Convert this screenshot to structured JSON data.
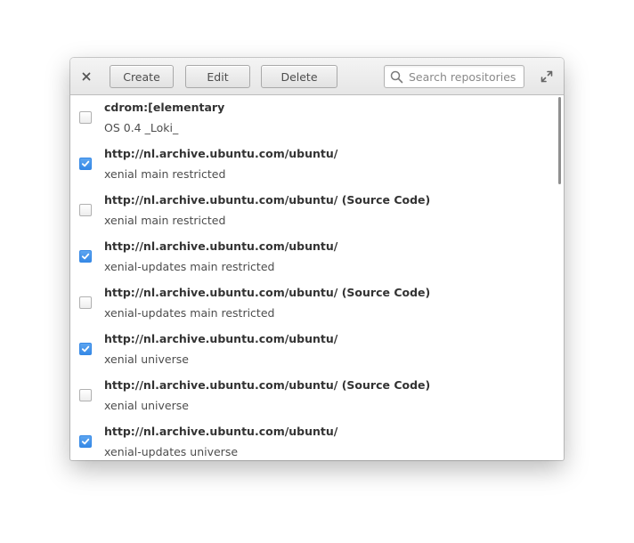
{
  "toolbar": {
    "create_label": "Create",
    "edit_label": "Edit",
    "delete_label": "Delete",
    "search_placeholder": "Search repositories"
  },
  "icons": {
    "close": "close-icon",
    "search": "search-icon",
    "maximize": "maximize-icon",
    "check": "checkmark-icon"
  },
  "colors": {
    "checkbox_checked": "#3689e6",
    "checkbox_unchecked_border": "#b0b0b0"
  },
  "repositories": [
    {
      "title": "cdrom:[elementary",
      "subtitle": "OS 0.4 _Loki_",
      "enabled": false
    },
    {
      "title": "http://nl.archive.ubuntu.com/ubuntu/",
      "subtitle": "xenial main restricted",
      "enabled": true
    },
    {
      "title": "http://nl.archive.ubuntu.com/ubuntu/ (Source Code)",
      "subtitle": "xenial main restricted",
      "enabled": false
    },
    {
      "title": "http://nl.archive.ubuntu.com/ubuntu/",
      "subtitle": "xenial-updates main restricted",
      "enabled": true
    },
    {
      "title": "http://nl.archive.ubuntu.com/ubuntu/ (Source Code)",
      "subtitle": "xenial-updates main restricted",
      "enabled": false
    },
    {
      "title": "http://nl.archive.ubuntu.com/ubuntu/",
      "subtitle": "xenial universe",
      "enabled": true
    },
    {
      "title": "http://nl.archive.ubuntu.com/ubuntu/ (Source Code)",
      "subtitle": "xenial universe",
      "enabled": false
    },
    {
      "title": "http://nl.archive.ubuntu.com/ubuntu/",
      "subtitle": "xenial-updates universe",
      "enabled": true
    }
  ]
}
